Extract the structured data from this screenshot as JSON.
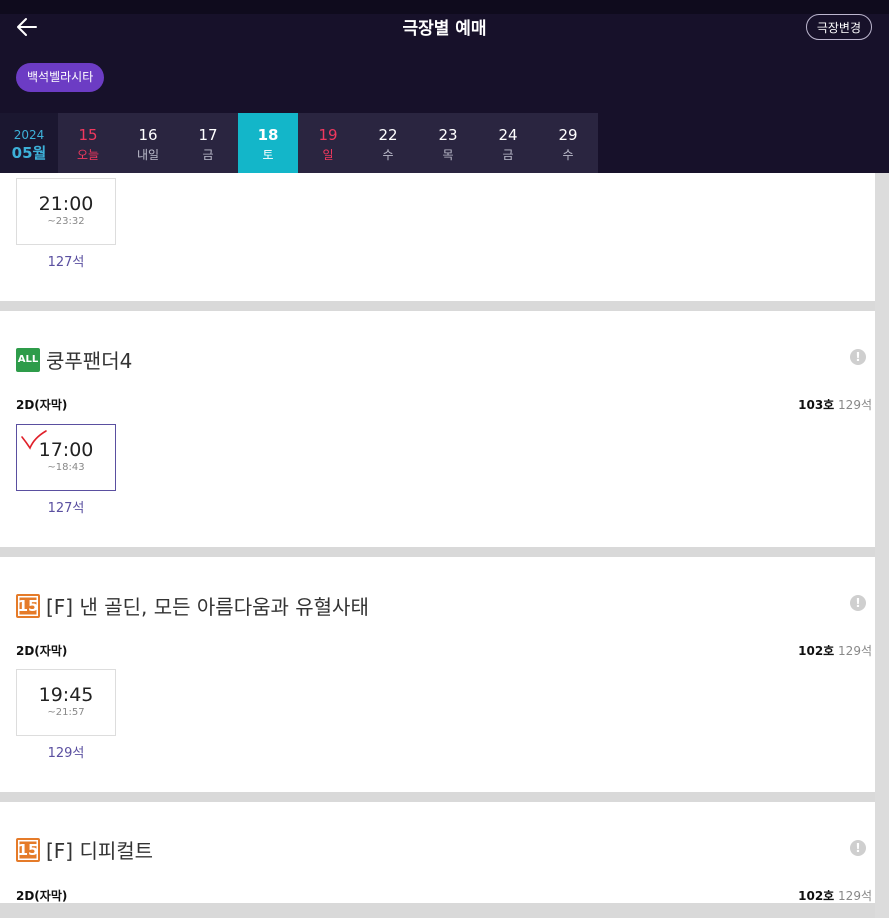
{
  "header": {
    "title": "극장별 예매",
    "change_label": "극장변경",
    "cinema": "백석벨라시타"
  },
  "calendar": {
    "year": "2024",
    "month": "05월",
    "days": [
      {
        "num": "15",
        "label": "오늘"
      },
      {
        "num": "16",
        "label": "내일"
      },
      {
        "num": "17",
        "label": "금"
      },
      {
        "num": "18",
        "label": "토"
      },
      {
        "num": "19",
        "label": "일"
      },
      {
        "num": "22",
        "label": "수"
      },
      {
        "num": "23",
        "label": "목"
      },
      {
        "num": "24",
        "label": "금"
      },
      {
        "num": "29",
        "label": "수"
      }
    ],
    "selected": "18"
  },
  "sections": [
    {
      "showtimes": [
        {
          "time": "21:00",
          "end": "~23:32",
          "seats": "127석"
        }
      ]
    },
    {
      "rating": "ALL",
      "title": "쿵푸팬더4",
      "format": "2D(자막)",
      "hall": "103호",
      "total_seats": "129석",
      "showtimes": [
        {
          "time": "17:00",
          "end": "~18:43",
          "seats": "127석"
        }
      ]
    },
    {
      "rating": "15",
      "title": "[F] 낸 골딘, 모든 아름다움과 유혈사태",
      "format": "2D(자막)",
      "hall": "102호",
      "total_seats": "129석",
      "showtimes": [
        {
          "time": "19:45",
          "end": "~21:57",
          "seats": "129석"
        }
      ]
    },
    {
      "rating": "15",
      "title": "[F] 디피컬트",
      "format": "2D(자막)",
      "hall": "102호",
      "total_seats": "129석"
    }
  ],
  "icons": {
    "back": "arrow-left-icon",
    "info": "info-icon",
    "selected_mark": "checkmark-icon"
  },
  "colors": {
    "header_bg": "#17112a",
    "accent_purple": "#6c3cc4",
    "selected_day": "#13b6c9",
    "holiday_red": "#f0385e",
    "rating_all": "#2e9c4a",
    "rating_15": "#e57b29"
  }
}
